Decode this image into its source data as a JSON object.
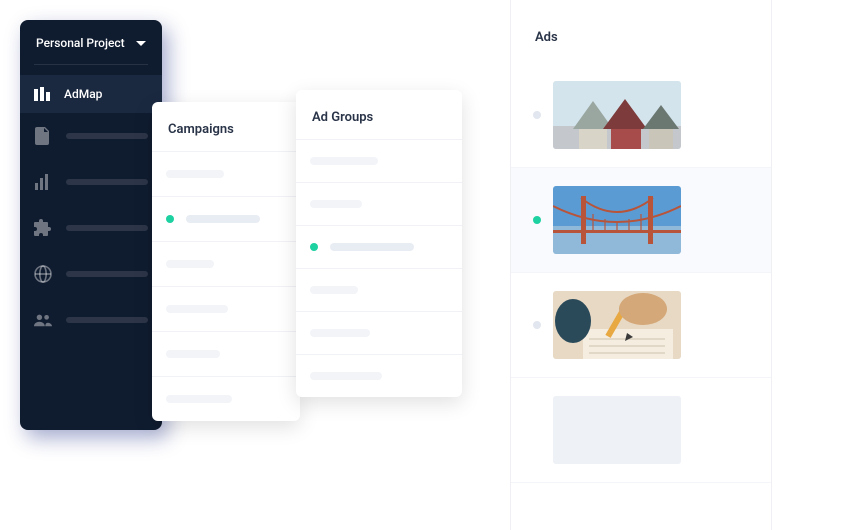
{
  "sidebar": {
    "project_label": "Personal Project",
    "active_label": "AdMap",
    "icons": [
      "admap-icon",
      "document-icon",
      "chart-icon",
      "puzzle-icon",
      "globe-icon",
      "people-icon"
    ]
  },
  "campaigns": {
    "title": "Campaigns",
    "rows": [
      {
        "dot": null,
        "w": 58,
        "light": true
      },
      {
        "dot": "green",
        "w": 74,
        "light": false
      },
      {
        "dot": null,
        "w": 48,
        "light": true
      },
      {
        "dot": null,
        "w": 62,
        "light": true
      },
      {
        "dot": null,
        "w": 54,
        "light": true
      },
      {
        "dot": null,
        "w": 66,
        "light": true
      }
    ]
  },
  "adgroups": {
    "title": "Ad Groups",
    "rows": [
      {
        "dot": null,
        "w": 68,
        "light": true
      },
      {
        "dot": null,
        "w": 52,
        "light": true
      },
      {
        "dot": "green",
        "w": 84,
        "light": false
      },
      {
        "dot": null,
        "w": 48,
        "light": true
      },
      {
        "dot": null,
        "w": 60,
        "light": true
      },
      {
        "dot": null,
        "w": 72,
        "light": true
      }
    ]
  },
  "ads": {
    "title": "Ads",
    "rows": [
      {
        "dot": "gray",
        "thumb": "houses",
        "selected": false
      },
      {
        "dot": "green",
        "thumb": "bridge",
        "selected": true
      },
      {
        "dot": "gray",
        "thumb": "writing",
        "selected": false
      },
      {
        "dot": null,
        "thumb": "blank",
        "selected": false
      }
    ]
  }
}
